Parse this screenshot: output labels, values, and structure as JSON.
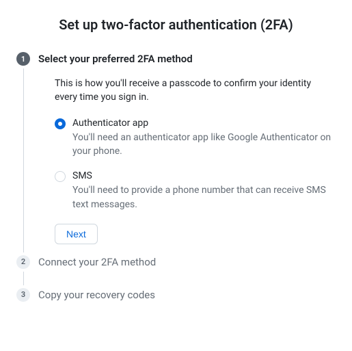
{
  "title": "Set up two-factor authentication (2FA)",
  "steps": [
    {
      "number": "1",
      "title": "Select your preferred 2FA method",
      "active": true,
      "description": "This is how you'll receive a passcode to confirm your identity every time you sign in.",
      "options": [
        {
          "label": "Authenticator app",
          "description": "You'll need an authenticator app like Google Authenticator on your phone.",
          "selected": true
        },
        {
          "label": "SMS",
          "description": "You'll need to provide a phone number that can receive SMS text messages.",
          "selected": false
        }
      ],
      "next_label": "Next"
    },
    {
      "number": "2",
      "title": "Connect your 2FA method",
      "active": false
    },
    {
      "number": "3",
      "title": "Copy your recovery codes",
      "active": false
    }
  ]
}
